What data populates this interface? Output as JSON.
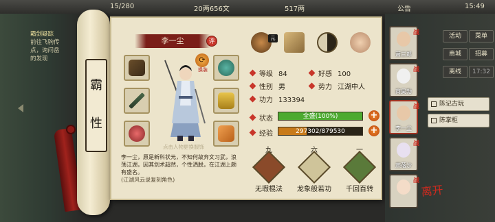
{
  "topbar": {
    "stamina": "15/280",
    "copper": "20两656文",
    "silver": "517两",
    "notice": "公告",
    "clock": "15:49"
  },
  "quest": {
    "title": "霸剑疑踪",
    "lines": [
      "前往飞驹传",
      "点，询问岳",
      "的发现"
    ]
  },
  "scroll_label": [
    "霸",
    "性"
  ],
  "character": {
    "name": "李一尘",
    "comment_badge": "评",
    "change_label": "换装",
    "hint": "点击人物更换服饰",
    "description": "李一尘，原是新科状元，不知何故弃文习武，浪荡江湖，因其剑术超然，个性洒脱，在江湖上颇有盛名。",
    "note": "(江湖风云录复刻角色)"
  },
  "top_icons": [
    {
      "name": "treasure-pot-icon",
      "badge": "元"
    },
    {
      "name": "map-scroll-icon"
    },
    {
      "name": "yin-yang-icon"
    },
    {
      "name": "meridian-body-icon"
    }
  ],
  "stats": {
    "level_label": "等级",
    "level": "84",
    "favor_label": "好感",
    "favor": "100",
    "gender_label": "性别",
    "gender": "男",
    "faction_label": "势力",
    "faction": "江湖中人",
    "power_label": "功力",
    "power": "133394",
    "status_label": "状态",
    "status_text": "全盛(100%)",
    "status_ratio": 1.0,
    "exp_label": "经验",
    "exp_text": "297302/879530",
    "exp_ratio": 0.338
  },
  "skills": [
    {
      "level": "九",
      "name": "无瑕棍法"
    },
    {
      "level": "六",
      "name": "龙象般若功"
    },
    {
      "level": "一",
      "name": "千回百转"
    }
  ],
  "right_menu": {
    "activity": "活动",
    "menu": "菜单",
    "shop": "商城",
    "recruit": "招募",
    "offline": "离线",
    "time": "17:32"
  },
  "side_buttons": {
    "notes": "陈记古玩",
    "teahouse": "陈掌柜"
  },
  "party": [
    {
      "name": "萧三郎"
    },
    {
      "name": "商昊勃"
    },
    {
      "name": "李一尘"
    },
    {
      "name": "燕落沙"
    },
    {
      "name": ""
    }
  ],
  "party_badge": "战",
  "exit_logo": "离开",
  "colors": {
    "banner": "#7a1e18",
    "status_fill": "#4caa30",
    "exp_fill": "#c87a1a",
    "accent_red": "#c8362a"
  }
}
